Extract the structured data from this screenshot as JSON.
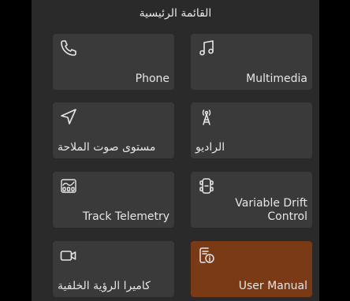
{
  "header": {
    "title": "القائمة الرئيسية"
  },
  "tiles": [
    {
      "label": "Phone",
      "icon": "phone-icon"
    },
    {
      "label": "Multimedia",
      "icon": "music-note-icon"
    },
    {
      "label": "مستوى صوت الملاحة",
      "icon": "navigation-arrow-icon"
    },
    {
      "label": "الراديو",
      "icon": "radio-tower-icon"
    },
    {
      "label": "Track Telemetry",
      "icon": "telemetry-icon"
    },
    {
      "label": "Variable Drift\nControl",
      "icon": "drift-control-icon"
    },
    {
      "label": "كاميرا الرؤية الخلفية",
      "icon": "camera-icon"
    },
    {
      "label": "User Manual",
      "icon": "manual-info-icon"
    }
  ],
  "colors": {
    "panel": "#2a2a2a",
    "tile": "#3a3a3a",
    "active_tile": "#7a3a16",
    "text": "#e6e6e6"
  }
}
